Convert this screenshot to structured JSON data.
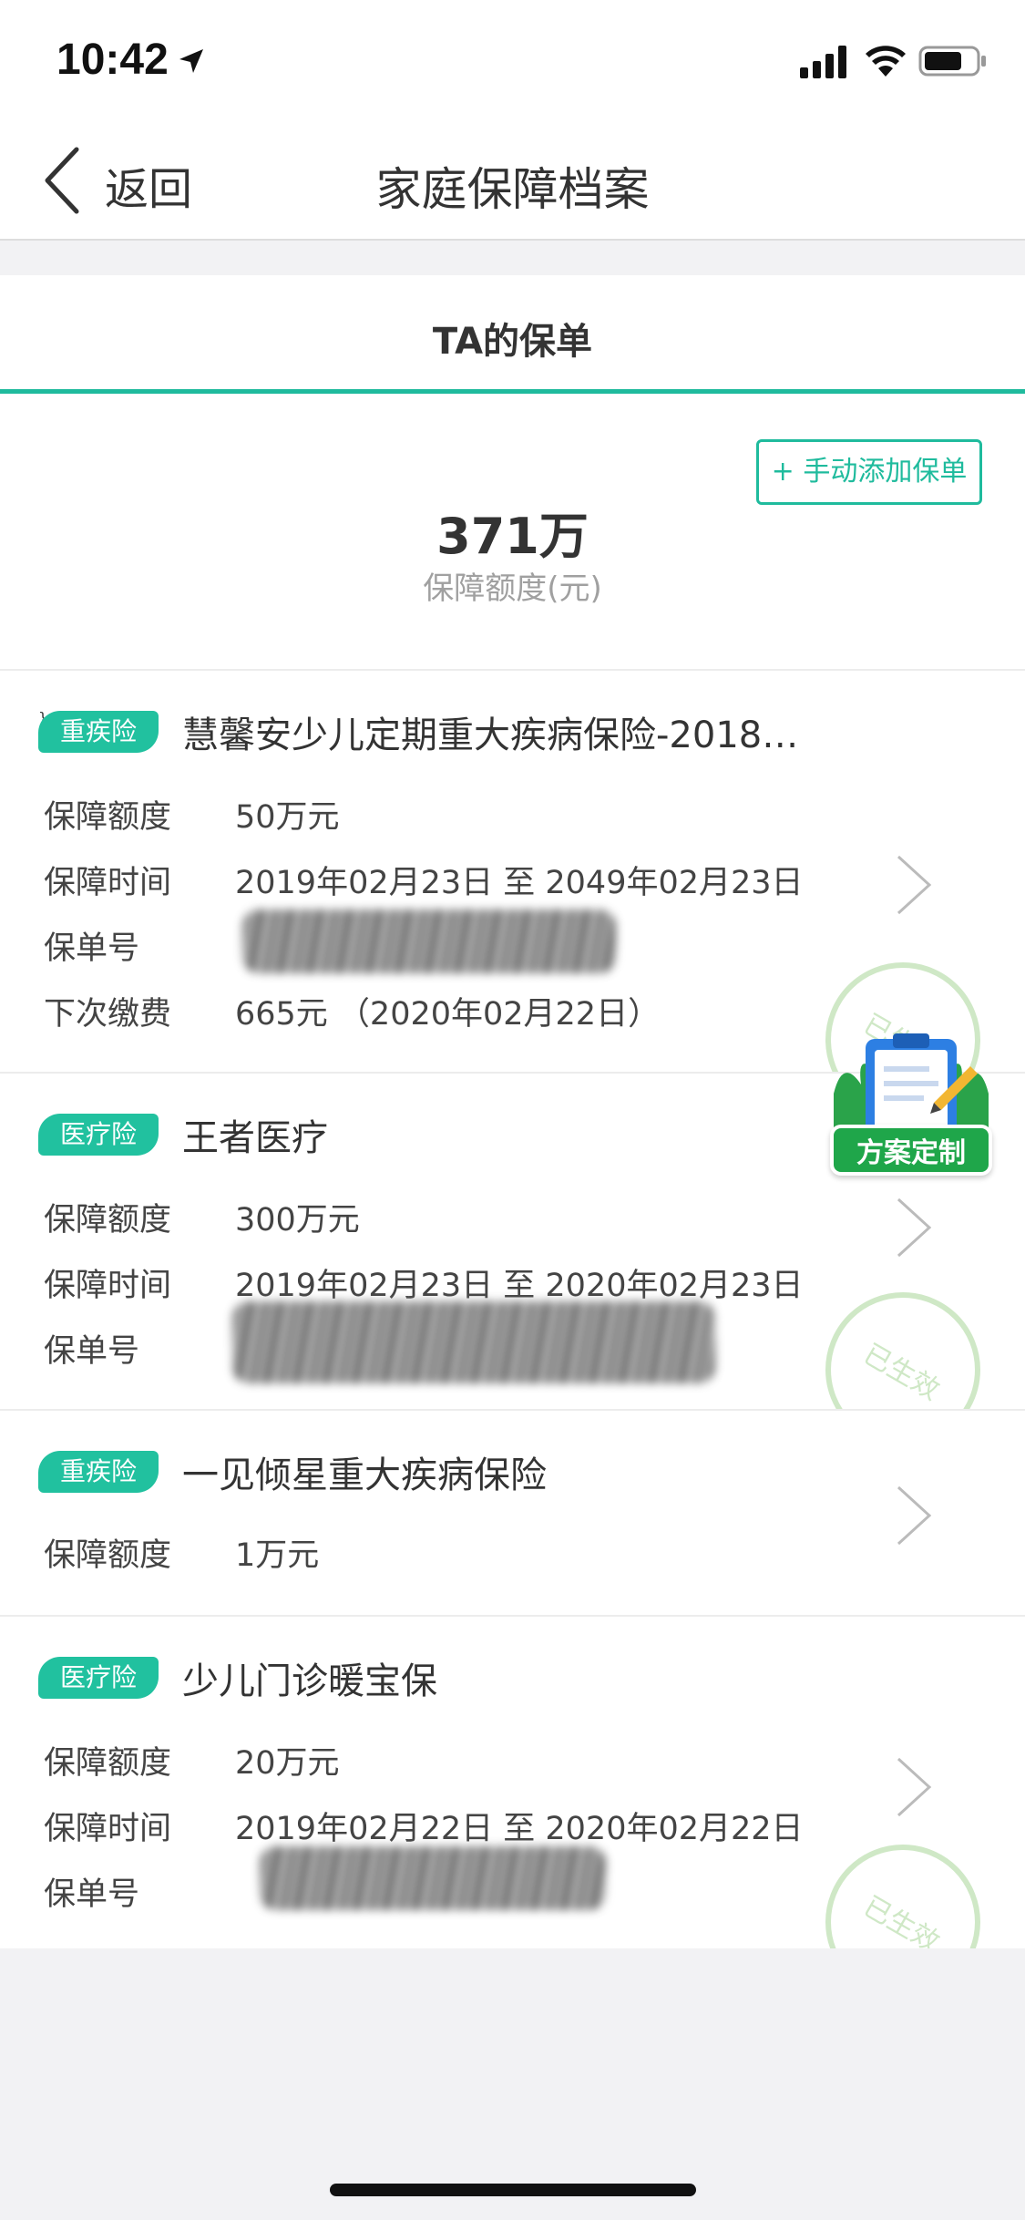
{
  "status_bar": {
    "time": "10:42"
  },
  "nav": {
    "back_label": "返回",
    "title": "家庭保障档案"
  },
  "tab": {
    "label": "TA的保单"
  },
  "summary": {
    "add_button_label": "+ 手动添加保单",
    "total_amount": "371万",
    "total_label": "保障额度(元)"
  },
  "floating_badge": {
    "label": "方案定制"
  },
  "stamp_label": "已生效",
  "policies": [
    {
      "tag": "重疾险",
      "name": "慧馨安少儿定期重大疾病保险-2018…",
      "coverage_label": "保障额度",
      "coverage_value": "50万元",
      "period_label": "保障时间",
      "period_value": "2019年02月23日 至 2049年02月23日",
      "number_label": "保单号",
      "next_payment_label": "下次缴费",
      "next_payment_value": "665元 （2020年02月22日）"
    },
    {
      "tag": "医疗险",
      "name": "王者医疗",
      "coverage_label": "保障额度",
      "coverage_value": "300万元",
      "period_label": "保障时间",
      "period_value": "2019年02月23日 至 2020年02月23日",
      "number_label": "保单号"
    },
    {
      "tag": "重疾险",
      "name": "一见倾星重大疾病保险",
      "coverage_label": "保障额度",
      "coverage_value": "1万元"
    },
    {
      "tag": "医疗险",
      "name": "少儿门诊暖宝保",
      "coverage_label": "保障额度",
      "coverage_value": "20万元",
      "period_label": "保障时间",
      "period_value": "2019年02月22日 至 2020年02月22日",
      "number_label": "保单号"
    }
  ],
  "colors": {
    "accent": "#1fbb9d",
    "tag_bg": "#21c19f",
    "stamp": "#cfe8c6",
    "badge_green": "#1fa64a"
  }
}
